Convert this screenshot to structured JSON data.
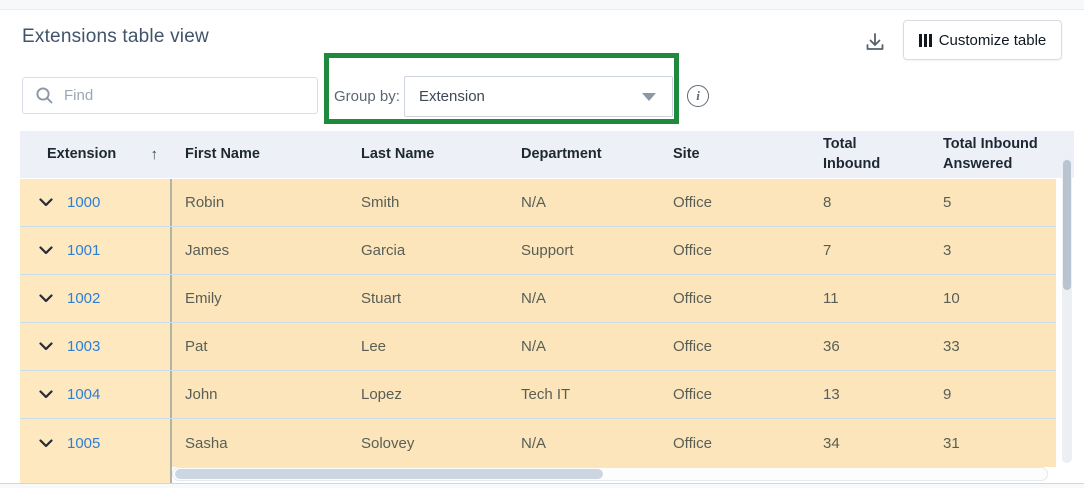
{
  "page": {
    "title": "Extensions table view"
  },
  "toolbar": {
    "download_icon": "download-icon",
    "customize_button": {
      "icon": "columns-icon",
      "label": "Customize table"
    }
  },
  "filters": {
    "find": {
      "placeholder": "Find",
      "value": "",
      "icon": "search-icon"
    },
    "group_by": {
      "label": "Group by:",
      "selected_option": "Extension",
      "highlight_color": "#1f8a3d"
    },
    "info_icon": "info-icon",
    "info_glyph": "i"
  },
  "table": {
    "sort": {
      "column": "Extension",
      "direction": "ascending",
      "icon": "↑"
    },
    "columns": [
      "Extension",
      "First Name",
      "Last Name",
      "Department",
      "Site",
      "Total Inbound",
      "Total Inbound Answered"
    ],
    "rows": [
      {
        "extension": "1000",
        "first_name": "Robin",
        "last_name": "Smith",
        "department": "N/A",
        "site": "Office",
        "total_inbound": "8",
        "total_inbound_answered": "5"
      },
      {
        "extension": "1001",
        "first_name": "James",
        "last_name": "Garcia",
        "department": "Support",
        "site": "Office",
        "total_inbound": "7",
        "total_inbound_answered": "3"
      },
      {
        "extension": "1002",
        "first_name": "Emily",
        "last_name": "Stuart",
        "department": "N/A",
        "site": "Office",
        "total_inbound": "11",
        "total_inbound_answered": "10"
      },
      {
        "extension": "1003",
        "first_name": "Pat",
        "last_name": "Lee",
        "department": "N/A",
        "site": "Office",
        "total_inbound": "36",
        "total_inbound_answered": "33"
      },
      {
        "extension": "1004",
        "first_name": "John",
        "last_name": "Lopez",
        "department": "Tech IT",
        "site": "Office",
        "total_inbound": "13",
        "total_inbound_answered": "9"
      },
      {
        "extension": "1005",
        "first_name": "Sasha",
        "last_name": "Solovey",
        "department": "N/A",
        "site": "Office",
        "total_inbound": "34",
        "total_inbound_answered": "31"
      }
    ]
  },
  "colors": {
    "row_background": "#fce5bb",
    "frozen_column_background": "#fde8c0",
    "header_background": "#edf0f6",
    "link_blue": "#2e7ed6",
    "highlight_green": "#1f8a3d"
  }
}
